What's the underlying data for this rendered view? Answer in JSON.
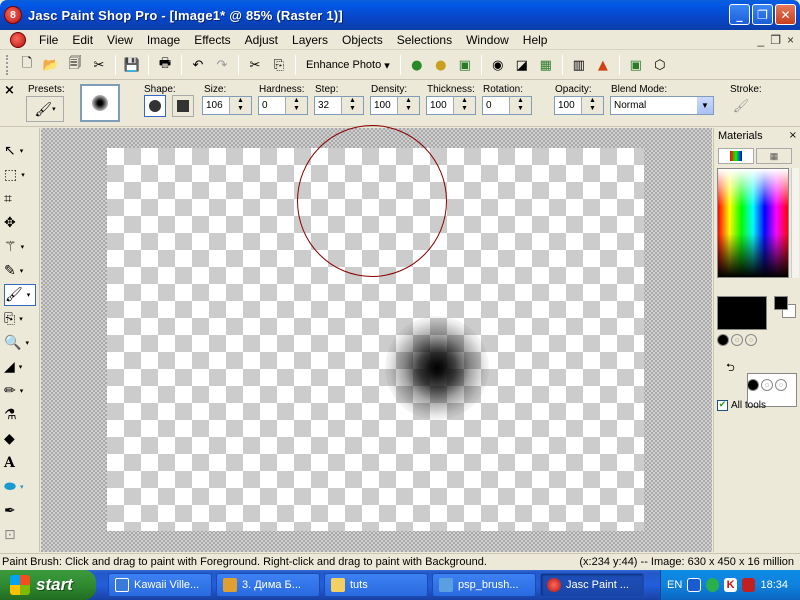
{
  "window": {
    "title": "Jasc Paint Shop Pro - [Image1* @  85% (Raster 1)]",
    "app_icon_label": "8",
    "buttons": [
      "_",
      "❐",
      "✕"
    ]
  },
  "menu": {
    "items": [
      "File",
      "Edit",
      "View",
      "Image",
      "Effects",
      "Adjust",
      "Layers",
      "Objects",
      "Selections",
      "Window",
      "Help"
    ],
    "mdi_buttons": [
      "_",
      "❐",
      "×"
    ]
  },
  "toolbar": {
    "enhance_label": "Enhance Photo",
    "enhance_arrow": "▾"
  },
  "tool_options": {
    "close": "×",
    "presets_label": "Presets:",
    "shape_label": "Shape:",
    "size_label": "Size:",
    "size_value": "106",
    "hardness_label": "Hardness:",
    "hardness_value": "0",
    "step_label": "Step:",
    "step_value": "32",
    "density_label": "Density:",
    "density_value": "100",
    "thickness_label": "Thickness:",
    "thickness_value": "100",
    "rotation_label": "Rotation:",
    "rotation_value": "0",
    "opacity_label": "Opacity:",
    "opacity_value": "100",
    "blend_label": "Blend Mode:",
    "blend_value": "Normal",
    "stroke_label": "Stroke:"
  },
  "materials": {
    "title": "Materials",
    "close": "×",
    "all_tools_label": "All tools",
    "all_tools_checked": true,
    "foreground_color": "#000000",
    "background_color": "#ffffff"
  },
  "status": {
    "left": "Paint Brush: Click and drag to paint with Foreground. Right-click and drag to paint with Background.",
    "right": "(x:234 y:44) -- Image:  630 x 450 x 16 million"
  },
  "taskbar": {
    "start_label": "start",
    "tasks": [
      "Kawaii Ville...",
      "3. Дима Б...",
      "tuts",
      "psp_brush...",
      "Jasc Paint ..."
    ],
    "language": "EN",
    "clock": "18:34"
  }
}
